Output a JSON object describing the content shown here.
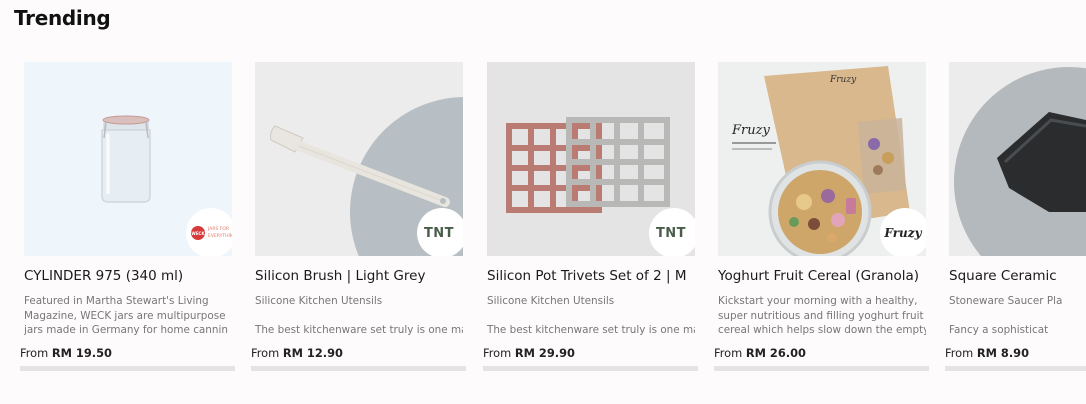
{
  "section": {
    "title": "Trending"
  },
  "products": [
    {
      "title": "CYLINDER 975 (340 ml)",
      "desc_lines": [
        "Featured in Martha Stewart's Living",
        "Magazine, WECK jars are multipurpose",
        "jars made in Germany for home cannin"
      ],
      "price_prefix": "From",
      "price": "RM 19.50",
      "badge_text": "JARS FOR EVERYTHING",
      "badge_brand": "WECK",
      "image_icon": "glass-jar-icon"
    },
    {
      "title": "Silicon Brush | Light Grey",
      "desc_lines": [
        "Silicone Kitchen Utensils",
        "",
        "The best kitchenware set truly is one ma"
      ],
      "price_prefix": "From",
      "price": "RM 12.90",
      "badge_text": "TNT",
      "image_icon": "basting-brush-icon"
    },
    {
      "title": "Silicon Pot Trivets Set of 2 | M",
      "desc_lines": [
        "Silicone Kitchen Utensils",
        "",
        "The best kitchenware set truly is one ma"
      ],
      "price_prefix": "From",
      "price": "RM 29.90",
      "badge_text": "TNT",
      "image_icon": "trivet-icon"
    },
    {
      "title": "Yoghurt Fruit Cereal (Granola)",
      "desc_lines": [
        "Kickstart your morning with a healthy,",
        "super nutritious and filling yoghurt fruit",
        "cereal which helps slow down the empty"
      ],
      "price_prefix": "From",
      "price": "RM 26.00",
      "badge_text": "Fruzy",
      "image_icon": "granola-bowl-icon"
    },
    {
      "title": "Square Ceramic",
      "desc_lines": [
        "Stoneware Saucer Pla",
        "",
        "Fancy a sophisticat"
      ],
      "price_prefix": "From",
      "price": "RM 8.90",
      "image_icon": "ceramic-dish-icon"
    }
  ]
}
